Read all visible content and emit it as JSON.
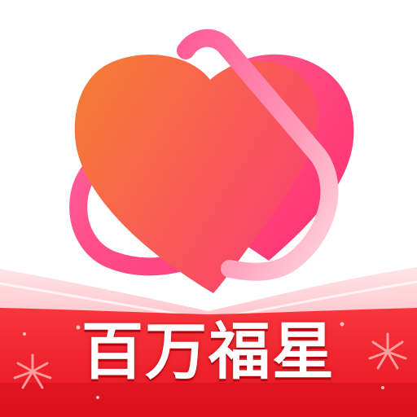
{
  "banner": {
    "text": "百万福星"
  },
  "icons": {
    "logo": "heart-with-loop-icon",
    "sparkle_left": "firework-sparkle-icon",
    "sparkle_right": "firework-sparkle-icon"
  },
  "colors": {
    "heart_start": "#f67a37",
    "heart_end": "#fb3e73",
    "heart_back_start": "#ff4f86",
    "heart_back_end": "#ff2f6f",
    "loop_start": "#ff6ea2",
    "loop_end": "#ffd5df",
    "banner_red": "#f2232d",
    "banner_dark_red": "#d40f1c",
    "banner_pink_wave": "#ffd9de",
    "text": "#ffffff"
  }
}
